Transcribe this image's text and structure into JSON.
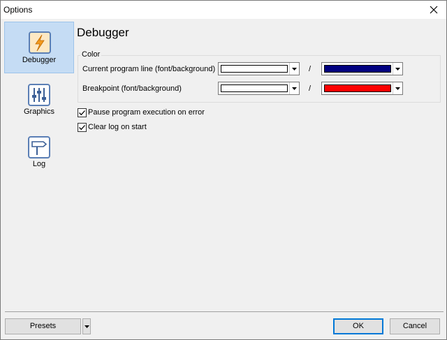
{
  "window": {
    "title": "Options"
  },
  "nav": {
    "items": [
      {
        "label": "Debugger",
        "icon": "lightning-icon",
        "selected": true
      },
      {
        "label": "Graphics",
        "icon": "sliders-icon",
        "selected": false
      },
      {
        "label": "Log",
        "icon": "signpost-icon",
        "selected": false
      }
    ]
  },
  "page": {
    "heading": "Debugger",
    "color_group": {
      "title": "Color",
      "separator": "/",
      "rows": [
        {
          "label": "Current program line (font/background)",
          "font_color": "#ffffff",
          "background_color": "#000080"
        },
        {
          "label": "Breakpoint (font/background)",
          "font_color": "#ffffff",
          "background_color": "#ff0000"
        }
      ]
    },
    "checkboxes": [
      {
        "label": "Pause program execution on error",
        "checked": true
      },
      {
        "label": "Clear log on start",
        "checked": true
      }
    ]
  },
  "footer": {
    "presets_label": "Presets",
    "ok_label": "OK",
    "cancel_label": "Cancel"
  }
}
